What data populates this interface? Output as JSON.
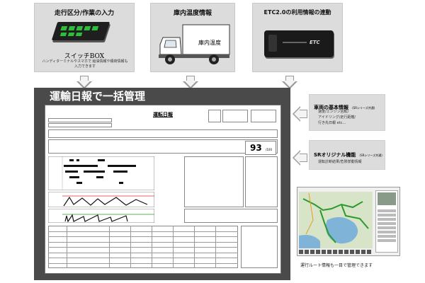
{
  "panels": {
    "switch_box": {
      "title": "走行区分/作業の入力",
      "device_label": "スイッチBOX",
      "description": "ハンディターミナルやスマホで 給油情報や積荷情報も入力できます"
    },
    "temperature": {
      "title": "庫内温度情報",
      "truck_sign": "庫内温度"
    },
    "etc": {
      "title": "ETC2.0の利用情報の連動",
      "device_brand": "ETC"
    }
  },
  "report": {
    "heading": "運輸日報で一括管理",
    "sheet_title": "運転日報",
    "score": "93",
    "score_denominator": "/100"
  },
  "side_info": {
    "basic": {
      "title": "車両の基本情報",
      "tag": "(SRシリーズ共通)",
      "details": [
        "速度/エンジン回転/",
        "アイドリング/走行距離/",
        "行き先日報 etc…"
      ]
    },
    "sr_original": {
      "title": "SRオリジナル機能",
      "tag": "(SRシリーズ共通)",
      "details": [
        "運転診断結果/危険挙動情報"
      ]
    },
    "route_caption": "運行ルート情報も一目で管理できます"
  },
  "colors": {
    "panel_bg": "#dcdcdc",
    "device_body": "#1f1f1f",
    "device_buttons": "#2bbf3a",
    "map_water": "#7fb4d8",
    "map_land": "#d8e4c8",
    "route_line": "#2a9a2a"
  }
}
